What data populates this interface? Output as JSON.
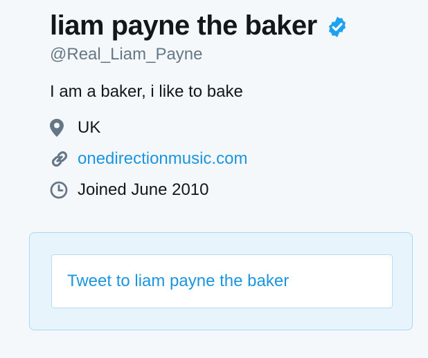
{
  "profile": {
    "display_name": "liam payne the baker",
    "verified_icon": "verified-badge-icon",
    "handle": "@Real_Liam_Payne",
    "bio": "I am a baker, i like to bake",
    "location": {
      "icon": "location-pin-icon",
      "text": "UK"
    },
    "website": {
      "icon": "link-icon",
      "text": "onedirectionmusic.com"
    },
    "joined": {
      "icon": "calendar-clock-icon",
      "text": "Joined June 2010"
    }
  },
  "tweet_to": {
    "label": "Tweet to liam payne the baker"
  },
  "colors": {
    "background": "#f5f8fa",
    "link": "#1b95e0",
    "verified": "#1da1f2",
    "secondary_text": "#657786",
    "tweet_box_bg": "#e8f4fb",
    "tweet_box_border": "#a4d9f9"
  }
}
